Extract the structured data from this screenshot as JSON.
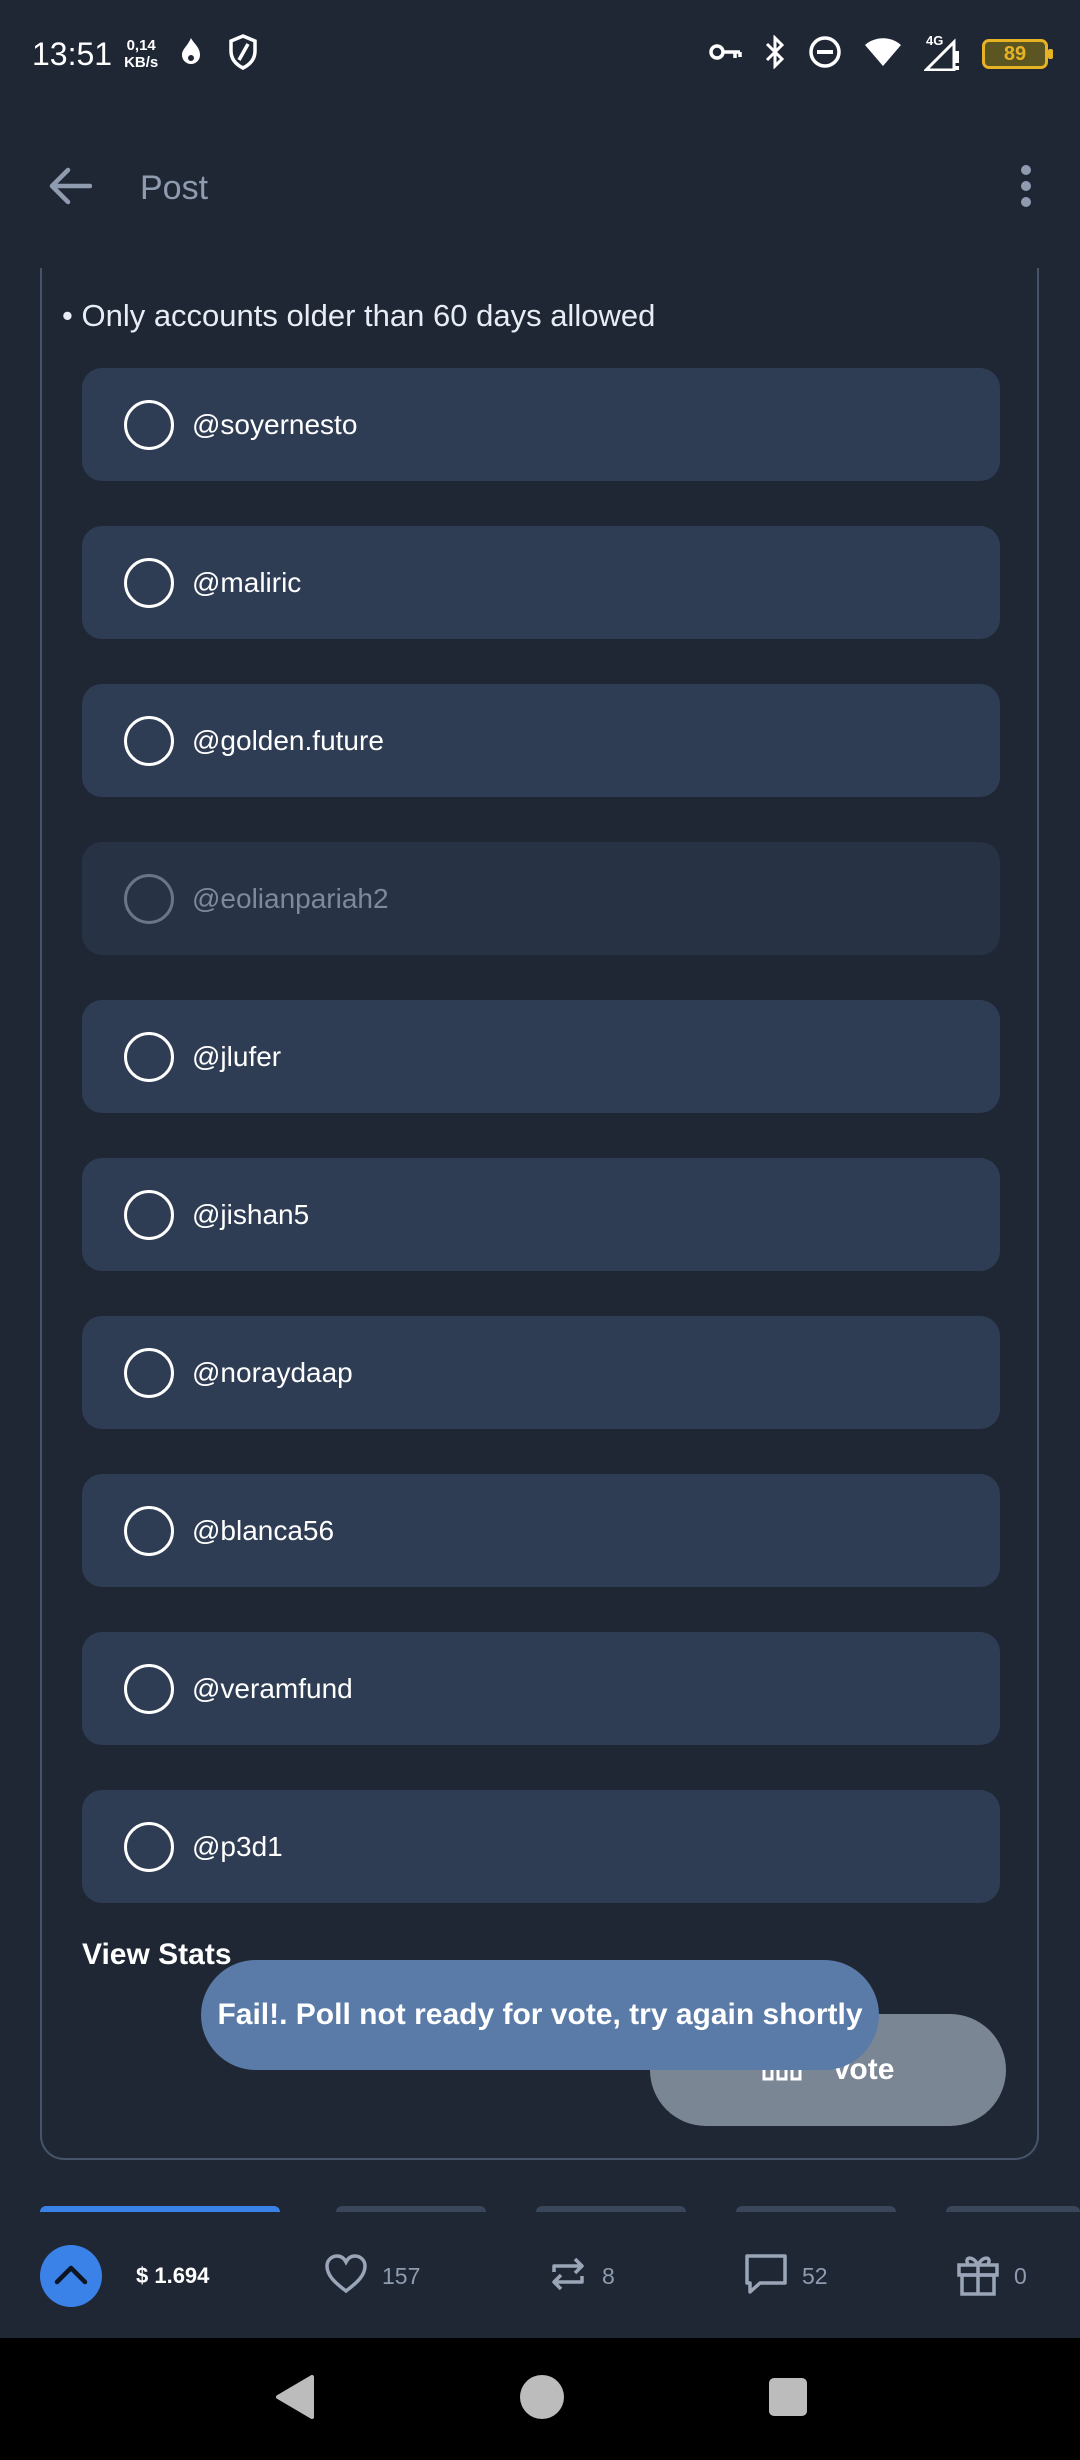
{
  "status_bar": {
    "time": "13:51",
    "net_speed_value": "0,14",
    "net_speed_unit": "KB/s",
    "network_type": "4G",
    "battery": "89",
    "icons": [
      "fire-icon",
      "shield-icon",
      "key-icon",
      "bluetooth-icon",
      "dnd-icon",
      "wifi-icon",
      "signal-icon"
    ]
  },
  "app_bar": {
    "title": "Post",
    "back_icon": "arrow-left-icon",
    "menu_icon": "more-vert-icon"
  },
  "poll": {
    "rule": "• Only accounts older than 60 days allowed",
    "options": [
      {
        "label": "@soyernesto",
        "enabled": true
      },
      {
        "label": "@maliric",
        "enabled": true
      },
      {
        "label": "@golden.future",
        "enabled": true
      },
      {
        "label": "@eolianpariah2",
        "enabled": false
      },
      {
        "label": "@jlufer",
        "enabled": true
      },
      {
        "label": "@jishan5",
        "enabled": true
      },
      {
        "label": "@noraydaap",
        "enabled": true
      },
      {
        "label": "@blanca56",
        "enabled": true
      },
      {
        "label": "@veramfund",
        "enabled": true
      },
      {
        "label": "@p3d1",
        "enabled": true
      }
    ],
    "view_stats": "View Stats",
    "vote_label": "Vote"
  },
  "toast": {
    "message": "Fail!. Poll not ready for vote, try again shortly"
  },
  "actions": {
    "payout": "$ 1.694",
    "likes": "157",
    "reblogs": "8",
    "comments": "52",
    "gifts": "0"
  },
  "colors": {
    "background": "#1f2735",
    "option_bg": "#2f3d54",
    "accent": "#3b82e8",
    "toast_bg": "#5a7aa8",
    "battery": "#e7b325"
  }
}
